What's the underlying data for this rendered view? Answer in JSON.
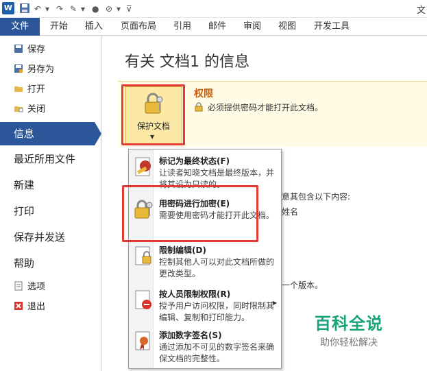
{
  "window": {
    "title": "文"
  },
  "qat": {
    "app_letter": "W"
  },
  "tabs": [
    "文件",
    "开始",
    "插入",
    "页面布局",
    "引用",
    "邮件",
    "审阅",
    "视图",
    "开发工具"
  ],
  "nav": {
    "small_top": [
      {
        "label": "保存",
        "icon": "save-icon"
      },
      {
        "label": "另存为",
        "icon": "save-as-icon"
      },
      {
        "label": "打开",
        "icon": "open-folder-icon"
      },
      {
        "label": "关闭",
        "icon": "close-folder-icon"
      }
    ],
    "info": "信息",
    "big": [
      "最近所用文件",
      "新建",
      "打印",
      "保存并发送",
      "帮助"
    ],
    "small_bottom": [
      {
        "label": "选项",
        "icon": "options-icon"
      },
      {
        "label": "退出",
        "icon": "exit-icon"
      }
    ]
  },
  "main": {
    "page_title": "有关 文档1 的信息",
    "protect_button": "保护文档",
    "perm_title": "权限",
    "perm_desc": "必须提供密码才能打开此文档。",
    "bg_lines": [
      "意其包含以下内容:",
      "姓名",
      "一个版本。"
    ]
  },
  "dropdown": {
    "items": [
      {
        "title": "标记为最终状态(F)",
        "desc": "让读者知晓文档是最终版本，并将其设为只读的。",
        "icon": "final-mark-icon"
      },
      {
        "title": "用密码进行加密(E)",
        "desc": "需要使用密码才能打开此文档。",
        "icon": "lock-key-icon"
      },
      {
        "title": "限制编辑(D)",
        "desc": "控制其他人可以对此文档所做的更改类型。",
        "icon": "restrict-edit-icon"
      },
      {
        "title": "按人员限制权限(R)",
        "desc": "授予用户访问权限，同时限制其编辑、复制和打印能力。",
        "icon": "restrict-people-icon"
      },
      {
        "title": "添加数字签名(S)",
        "desc": "通过添加不可见的数字签名来确保文档的完整性。",
        "icon": "signature-ribbon-icon"
      }
    ]
  },
  "watermark": {
    "main": "百科全说",
    "sub": "助你轻松解决"
  },
  "colors": {
    "accent": "#2b579a",
    "highlight_box": "#e53935",
    "perm_title": "#c65e0a"
  }
}
